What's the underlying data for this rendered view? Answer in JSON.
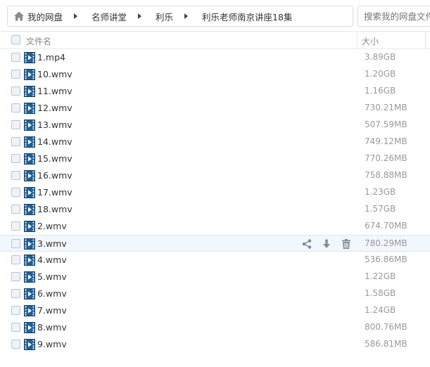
{
  "breadcrumb": [
    "我的网盘",
    "名师讲堂",
    "利乐",
    "利乐老师南京讲座18集"
  ],
  "search": {
    "placeholder": "搜索我的网盘文件"
  },
  "header": {
    "name": "文件名",
    "size": "大小"
  },
  "files": [
    {
      "name": "1.mp4",
      "size": "3.89GB"
    },
    {
      "name": "10.wmv",
      "size": "1.20GB"
    },
    {
      "name": "11.wmv",
      "size": "1.16GB"
    },
    {
      "name": "12.wmv",
      "size": "730.21MB"
    },
    {
      "name": "13.wmv",
      "size": "507.59MB"
    },
    {
      "name": "14.wmv",
      "size": "749.12MB"
    },
    {
      "name": "15.wmv",
      "size": "770.26MB"
    },
    {
      "name": "16.wmv",
      "size": "758.88MB"
    },
    {
      "name": "17.wmv",
      "size": "1.23GB"
    },
    {
      "name": "18.wmv",
      "size": "1.57GB"
    },
    {
      "name": "2.wmv",
      "size": "674.70MB"
    },
    {
      "name": "3.wmv",
      "size": "780.29MB",
      "hovered": true
    },
    {
      "name": "4.wmv",
      "size": "536.86MB"
    },
    {
      "name": "5.wmv",
      "size": "1.22GB"
    },
    {
      "name": "6.wmv",
      "size": "1.58GB"
    },
    {
      "name": "7.wmv",
      "size": "1.24GB"
    },
    {
      "name": "8.wmv",
      "size": "800.76MB"
    },
    {
      "name": "9.wmv",
      "size": "586.81MB"
    }
  ],
  "row_actions": [
    "share-icon",
    "download-icon",
    "delete-icon"
  ],
  "icons": {
    "home": "home-icon",
    "video_file": "video-file-icon"
  },
  "colors": {
    "hover_row": "#f2f7fd",
    "muted_text": "#999999",
    "icon_blue": "#1f5f96"
  }
}
